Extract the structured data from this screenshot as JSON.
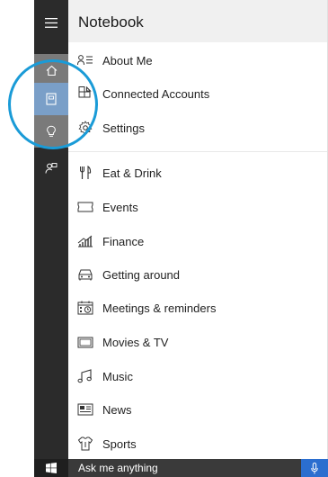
{
  "header": {
    "title": "Notebook"
  },
  "rail": {
    "icons": [
      "hamburger-icon",
      "home-icon",
      "notebook-icon",
      "lightbulb-icon",
      "feedback-icon"
    ]
  },
  "menu": {
    "items": [
      {
        "label": "About Me",
        "icon": "about-me-icon"
      },
      {
        "label": "Connected Accounts",
        "icon": "connected-accounts-icon"
      },
      {
        "label": "Settings",
        "icon": "gear-icon"
      },
      {
        "label": "Eat & Drink",
        "icon": "fork-knife-icon"
      },
      {
        "label": "Events",
        "icon": "ticket-icon"
      },
      {
        "label": "Finance",
        "icon": "finance-chart-icon"
      },
      {
        "label": "Getting around",
        "icon": "car-icon"
      },
      {
        "label": "Meetings & reminders",
        "icon": "calendar-reminder-icon"
      },
      {
        "label": "Movies & TV",
        "icon": "screen-icon"
      },
      {
        "label": "Music",
        "icon": "music-note-icon"
      },
      {
        "label": "News",
        "icon": "newspaper-icon"
      },
      {
        "label": "Sports",
        "icon": "trophy-shirt-icon"
      }
    ]
  },
  "taskbar": {
    "search_text": "Ask me anything",
    "start_icon": "windows-logo-icon",
    "mic_icon": "microphone-icon"
  },
  "colors": {
    "rail_bg": "#2b2b2b",
    "rail_active": "#7a9fc8",
    "rail_inactive": "#7a7a7a",
    "mic_bg": "#2b6ecf",
    "highlight": "#1a9bd7"
  }
}
